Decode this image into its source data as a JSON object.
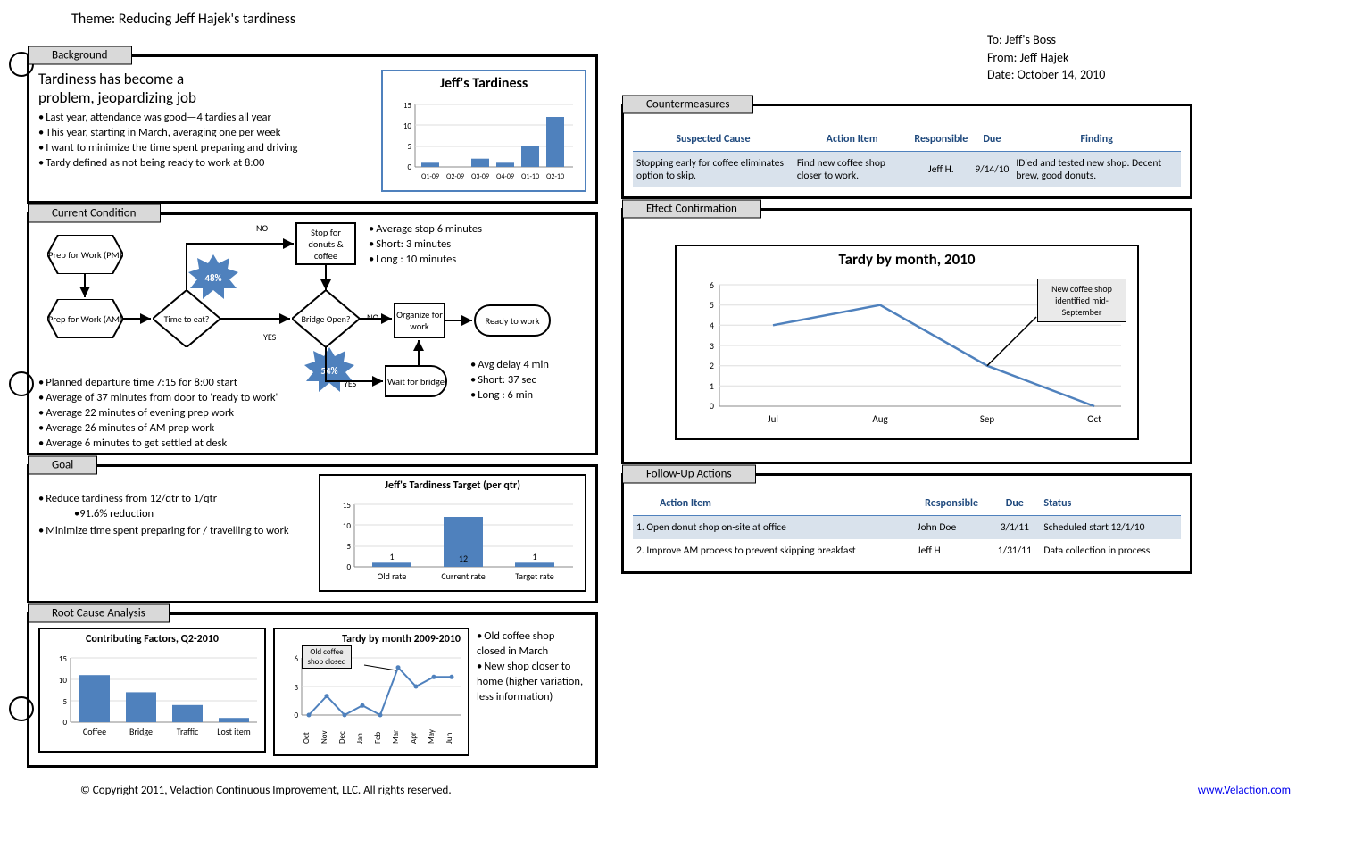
{
  "theme_label": "Theme: Reducing Jeff Hajek's tardiness",
  "to": "To: Jeff's Boss",
  "from": "From: Jeff Hajek",
  "date": "Date: October 14, 2010",
  "background": {
    "title": "Background",
    "lead1": "Tardiness has become a",
    "lead2": "problem, jeopardizing job",
    "bul1": "Last year, attendance was good—4 tardies all year",
    "bul2": "This year, starting in March, averaging one per week",
    "bul3": "I want to minimize the time spent preparing and driving",
    "bul4": "Tardy defined as not being ready to work at 8:00"
  },
  "current": {
    "title": "Current Condition",
    "pct48": "48%",
    "pct54": "54%",
    "prep_pm": "Prep for Work (PM)",
    "prep_am": "Prep for Work (AM)",
    "time_to_eat": "Time to eat?",
    "bridge_open": "Bridge Open?",
    "stop_donuts": "Stop for donuts & coffee",
    "organize": "Organize for work",
    "wait_bridge": "Wait for bridge",
    "ready": "Ready to work",
    "no": "NO",
    "yes": "YES",
    "stop_b1": "Average stop 6 minutes",
    "stop_b2": "Short: 3 minutes",
    "stop_b3": "Long : 10 minutes",
    "wait_b1": "Avg delay 4 min",
    "wait_b2": "Short: 37 sec",
    "wait_b3": "Long : 6 min",
    "bul1": "Planned departure time 7:15 for 8:00 start",
    "bul2": "Average of 37 minutes from door to 'ready to work'",
    "bul3": "Average 22 minutes of evening prep work",
    "bul4": "Average 26 minutes of AM prep work",
    "bul5": "Average 6 minutes to get settled at desk"
  },
  "goal": {
    "title": "Goal",
    "bul1": "Reduce tardiness from 12/qtr to 1/qtr",
    "sub1": "•91.6% reduction",
    "bul2": "Minimize time spent preparing for / travelling to work"
  },
  "rca": {
    "title": "Root Cause Analysis",
    "note1": "Old coffee shop closed in March",
    "note2": "New shop closer to home (higher variation, less information)",
    "callout": "Old coffee shop closed"
  },
  "counter": {
    "title": "Countermeasures",
    "h1": "Suspected Cause",
    "h2": "Action Item",
    "h3": "Responsible",
    "h4": "Due",
    "h5": "Finding",
    "r1c1": "Stopping early for coffee eliminates option to skip.",
    "r1c2": "Find new coffee shop closer to work.",
    "r1c3": "Jeff H.",
    "r1c4": "9/14/10",
    "r1c5": "ID'ed and tested new shop. Decent brew, good donuts."
  },
  "effect": {
    "title": "Effect Confirmation",
    "callout": "New coffee shop identified mid-September"
  },
  "followup": {
    "title": "Follow-Up Actions",
    "h1": "Action Item",
    "h2": "Responsible",
    "h3": "Due",
    "h4": "Status",
    "r1c1": "1. Open donut shop on-site at office",
    "r1c2": "John Doe",
    "r1c3": "3/1/11",
    "r1c4": "Scheduled start 12/1/10",
    "r2c1": "2. Improve AM process to prevent skipping breakfast",
    "r2c2": "Jeff H",
    "r2c3": "1/31/11",
    "r2c4": "Data collection in process"
  },
  "footer": {
    "copyright": "© Copyright 2011, Velaction Continuous Improvement, LLC. All rights reserved.",
    "link": "www.Velaction.com"
  },
  "chart_data": [
    {
      "name": "Jeff's Tardiness",
      "type": "bar",
      "title": "Jeff's Tardiness",
      "categories": [
        "Q1-09",
        "Q2-09",
        "Q3-09",
        "Q4-09",
        "Q1-10",
        "Q2-10"
      ],
      "values": [
        1,
        0,
        2,
        1,
        5,
        12
      ],
      "ylim": [
        0,
        15
      ],
      "yticks": [
        0,
        5,
        10,
        15
      ]
    },
    {
      "name": "Jeff's Tardiness Target (per qtr)",
      "type": "bar",
      "title": "Jeff's Tardiness Target (per qtr)",
      "categories": [
        "Old rate",
        "Current rate",
        "Target rate"
      ],
      "values": [
        1,
        12,
        1
      ],
      "data_labels": [
        "1",
        "12",
        "1"
      ],
      "ylim": [
        0,
        15
      ],
      "yticks": [
        0,
        5,
        10,
        15
      ]
    },
    {
      "name": "Contributing Factors, Q2-2010",
      "type": "bar",
      "title": "Contributing Factors, Q2-2010",
      "categories": [
        "Coffee",
        "Bridge",
        "Traffic",
        "Lost item"
      ],
      "values": [
        11,
        7,
        4,
        1
      ],
      "ylim": [
        0,
        15
      ],
      "yticks": [
        0,
        5,
        10,
        15
      ]
    },
    {
      "name": "Tardy by month 2009-2010",
      "type": "line",
      "title": "Tardy by month 2009-2010",
      "categories": [
        "Oct",
        "Nov",
        "Dec",
        "Jan",
        "Feb",
        "Mar",
        "Apr",
        "May",
        "Jun"
      ],
      "values": [
        0,
        2,
        0,
        1,
        0,
        5,
        3,
        4,
        4
      ],
      "ylim": [
        0,
        6
      ],
      "yticks": [
        0,
        3,
        6
      ],
      "annotation": "Old coffee shop closed"
    },
    {
      "name": "Tardy by month, 2010",
      "type": "line",
      "title": "Tardy by month, 2010",
      "categories": [
        "Jul",
        "Aug",
        "Sep",
        "Oct"
      ],
      "values": [
        4,
        5,
        2,
        0
      ],
      "ylim": [
        0,
        6
      ],
      "yticks": [
        0,
        1,
        2,
        3,
        4,
        5,
        6
      ],
      "annotation": "New coffee shop identified mid-September"
    }
  ]
}
